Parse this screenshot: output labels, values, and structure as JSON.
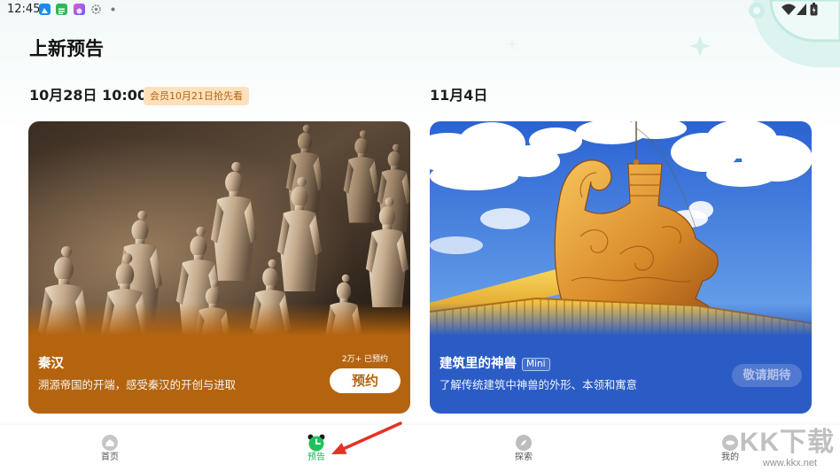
{
  "status_bar": {
    "time": "12:45",
    "notification_icons": [
      "app-blue-icon",
      "app-green-icon",
      "app-purple-icon",
      "settings-gear-icon",
      "dot-icon"
    ],
    "system_icons": [
      "wifi-icon",
      "cellular-signal-icon",
      "battery-icon"
    ]
  },
  "page_title": "上新预告",
  "sections": [
    {
      "date": "10月28日 10:00",
      "badge": "会员10月21日抢先看",
      "card": {
        "title": "秦汉",
        "subtitle": "溯源帝国的开端，感受秦汉的开创与进取",
        "reservations": "2万+ 已预约",
        "button": "预约",
        "button_enabled": true,
        "theme_color": "#b4640f"
      }
    },
    {
      "date": "11月4日",
      "card": {
        "title": "建筑里的神兽",
        "tag": "Mini",
        "subtitle": "了解传统建筑中神兽的外形、本领和寓意",
        "button": "敬请期待",
        "button_enabled": false,
        "theme_color": "#2b5cc5"
      }
    }
  ],
  "bottom_nav": [
    {
      "label": "首页",
      "icon": "home-icon",
      "active": false
    },
    {
      "label": "预告",
      "icon": "alarm-clock-icon",
      "active": true
    },
    {
      "label": "探索",
      "icon": "compass-icon",
      "active": false
    },
    {
      "label": "我的",
      "icon": "profile-icon",
      "active": false
    }
  ],
  "colors": {
    "nav_active": "#1fb155",
    "nav_inactive": "#c4c4c4",
    "badge_bg": "#fde1bd",
    "badge_text": "#b5620f",
    "annotation_arrow": "#e53226"
  },
  "watermark": {
    "brand": "KK下载",
    "url": "www.kkx.net"
  }
}
